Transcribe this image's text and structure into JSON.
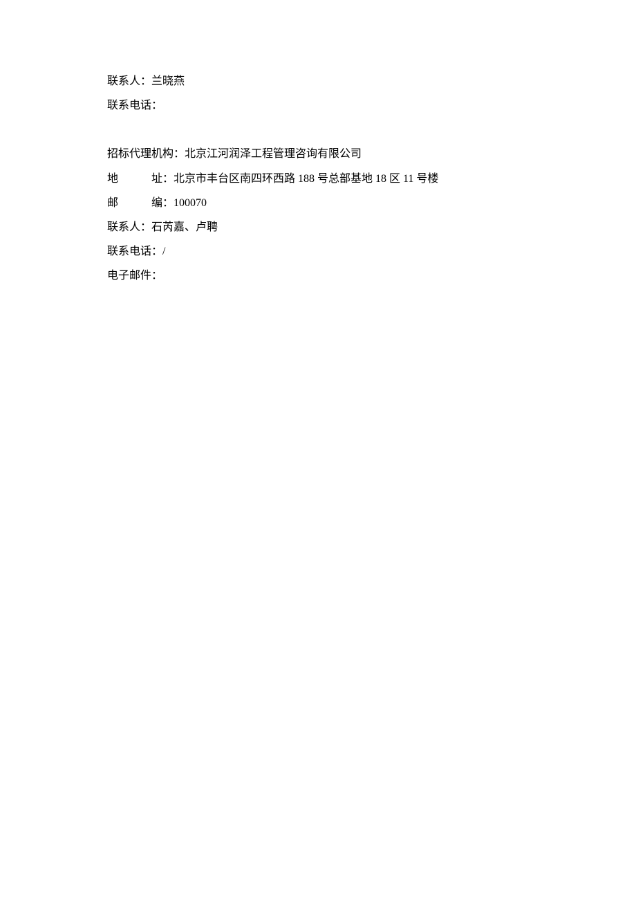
{
  "lines": {
    "l1": "联系人：兰晓燕",
    "l2": "联系电话：",
    "l3": "招标代理机构：北京江河润泽工程管理咨询有限公司",
    "l4": "地　　　址：北京市丰台区南四环西路 188 号总部基地 18 区 11 号楼",
    "l5": "邮　　　编：100070",
    "l6": "联系人：石芮嘉、卢聘",
    "l7": "联系电话：/",
    "l8": "电子邮件："
  }
}
